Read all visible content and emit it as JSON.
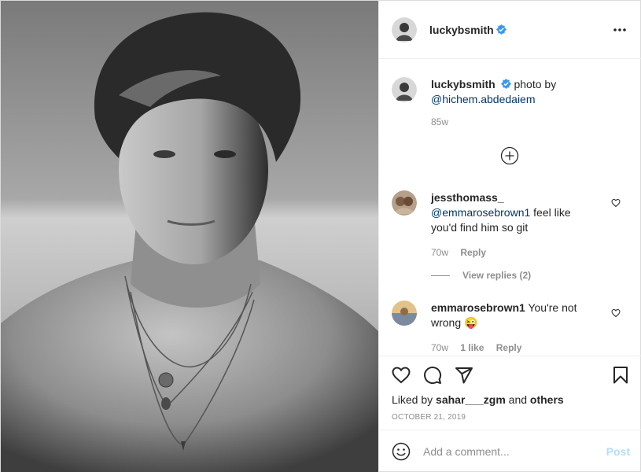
{
  "post": {
    "author": "luckybsmith",
    "more_icon": "more-horizontal-icon",
    "verified_color": "#3897f0",
    "image_alt": "black and white photo of a shirtless man with necklaces by the sea"
  },
  "caption": {
    "username": "luckybsmith",
    "text": " photo by",
    "mention": "@hichem.abdedaiem",
    "time": "85w"
  },
  "comments": [
    {
      "username": "jessthomass_",
      "mention": "@emmarosebrown1",
      "text": " feel like you'd find him so git",
      "time": "70w",
      "likes": "",
      "reply_label": "Reply",
      "view_replies": "View replies (2)"
    },
    {
      "username": "emmarosebrown1",
      "text": " You're not wrong",
      "emoji": "😜",
      "time": "70w",
      "likes": "1 like",
      "reply_label": "Reply"
    }
  ],
  "actions": {
    "like_icon": "heart-icon",
    "comment_icon": "comment-icon",
    "share_icon": "share-icon",
    "save_icon": "bookmark-icon"
  },
  "likes": {
    "prefix": "Liked by ",
    "user": "sahar___zgm",
    "middle": " and ",
    "others": "others"
  },
  "date": "October 21, 2019",
  "add_comment": {
    "placeholder": "Add a comment...",
    "post_label": "Post",
    "post_color": "#b2dffc"
  }
}
